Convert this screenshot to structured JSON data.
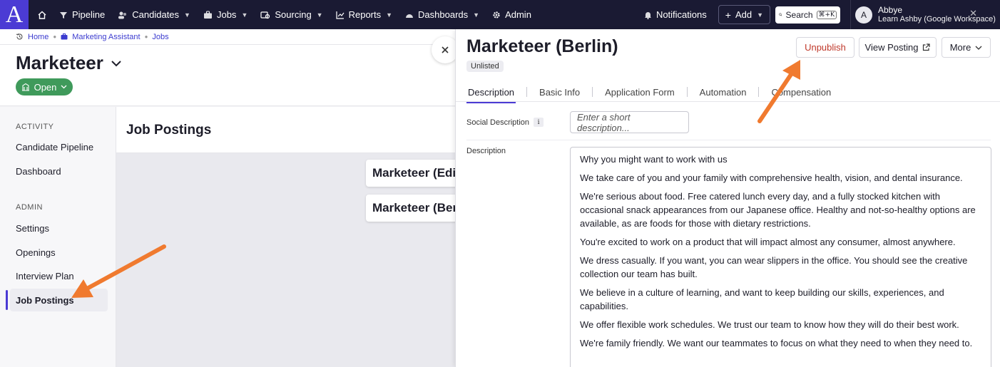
{
  "topnav": {
    "logo": "A",
    "items": [
      {
        "label": "Pipeline",
        "icon": "filter-icon",
        "caret": false
      },
      {
        "label": "Candidates",
        "icon": "people-icon",
        "caret": true
      },
      {
        "label": "Jobs",
        "icon": "briefcase-icon",
        "caret": true
      },
      {
        "label": "Sourcing",
        "icon": "sourcing-icon",
        "caret": true
      },
      {
        "label": "Reports",
        "icon": "chart-icon",
        "caret": true
      },
      {
        "label": "Dashboards",
        "icon": "gauge-icon",
        "caret": true
      },
      {
        "label": "Admin",
        "icon": "gear-icon",
        "caret": false
      }
    ],
    "notifications": "Notifications",
    "add": "Add",
    "search": "Search",
    "search_shortcut": "⌘+K",
    "user": {
      "initial": "A",
      "name": "Abbye",
      "org": "Learn Ashby (Google Workspace)"
    }
  },
  "breadcrumb": [
    "Home",
    "Marketing Assistant",
    "Jobs"
  ],
  "job": {
    "title": "Marketeer",
    "status": "Open"
  },
  "sidebar": {
    "sections": [
      {
        "title": "ACTIVITY",
        "items": [
          "Candidate Pipeline",
          "Dashboard"
        ]
      },
      {
        "title": "ADMIN",
        "items": [
          "Settings",
          "Openings",
          "Interview Plan",
          "Job Postings"
        ]
      }
    ],
    "active": "Job Postings"
  },
  "postings": {
    "title": "Job Postings",
    "cards": [
      "Marketeer (Edi",
      "Marketeer (Ber"
    ]
  },
  "panel": {
    "title": "Marketeer (Berlin)",
    "badge": "Unlisted",
    "buttons": {
      "unpublish": "Unpublish",
      "view": "View Posting",
      "more": "More"
    },
    "tabs": [
      "Description",
      "Basic Info",
      "Application Form",
      "Automation",
      "Compensation"
    ],
    "active_tab": "Description",
    "social_label": "Social Description",
    "social_placeholder": "Enter a short description...",
    "description_label": "Description",
    "description": [
      "Why you might want to work with us",
      "We take care of you and your family with comprehensive health, vision, and dental insurance.",
      "We're serious about food. Free catered lunch every day, and a fully stocked kitchen with occasional snack appearances from our Japanese office. Healthy and not-so-healthy options are available, as are foods for those with dietary restrictions.",
      "You're excited to work on a product that will impact almost any consumer, almost anywhere.",
      "We dress casually. If you want, you can wear slippers in the office. You should see the creative collection our team has built.",
      "We believe in a culture of learning, and want to keep building our skills, experiences, and capabilities.",
      "We offer flexible work schedules. We trust our team to know how they will do their best work.",
      "We're family friendly. We want our teammates to focus on what they need to when they need to."
    ]
  },
  "colors": {
    "accent": "#4b3bd4",
    "nav_bg": "#1a1a33",
    "open_green": "#3f9a5b",
    "unpublish_red": "#c0392b",
    "arrow_orange": "#f07a2f"
  }
}
